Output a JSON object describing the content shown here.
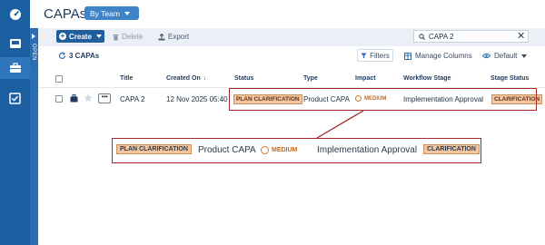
{
  "header": {
    "title": "CAPAs",
    "view_button": "By Team"
  },
  "sidebar": {
    "items": [
      {
        "icon": "dashboard-icon"
      },
      {
        "icon": "inbox-icon"
      },
      {
        "icon": "briefcase-icon",
        "active": true
      },
      {
        "icon": "checkbox-icon"
      }
    ],
    "open_label": "OPEN"
  },
  "toolbar": {
    "create_label": "Create",
    "delete_label": "Delete",
    "export_label": "Export",
    "search_value": "CAPA 2"
  },
  "subtoolbar": {
    "count_label": "3 CAPAs",
    "filters_label": "Filters",
    "manage_columns_label": "Manage Columns",
    "default_label": "Default"
  },
  "table": {
    "columns": [
      "Title",
      "Created On",
      "Status",
      "Type",
      "Impact",
      "Workflow Stage",
      "Stage Status"
    ],
    "rows": [
      {
        "title": "CAPA 2",
        "created_on": "12 Nov 2025 05:40",
        "status": "PLAN CLARIFICATION",
        "type": "Product CAPA",
        "impact": "MEDIUM",
        "workflow_stage": "Implementation Approval",
        "stage_status": "CLARIFICATION"
      }
    ]
  },
  "callout": {
    "status": "PLAN CLARIFICATION",
    "type": "Product CAPA",
    "impact": "MEDIUM",
    "workflow_stage": "Implementation Approval",
    "stage_status": "CLARIFICATION"
  },
  "colors": {
    "rail": "#1c5fa0",
    "accent": "#3f83c8",
    "badge_bg": "#f3c6a1",
    "impact_medium": "#d07a2a",
    "highlight": "#a52a2a"
  }
}
